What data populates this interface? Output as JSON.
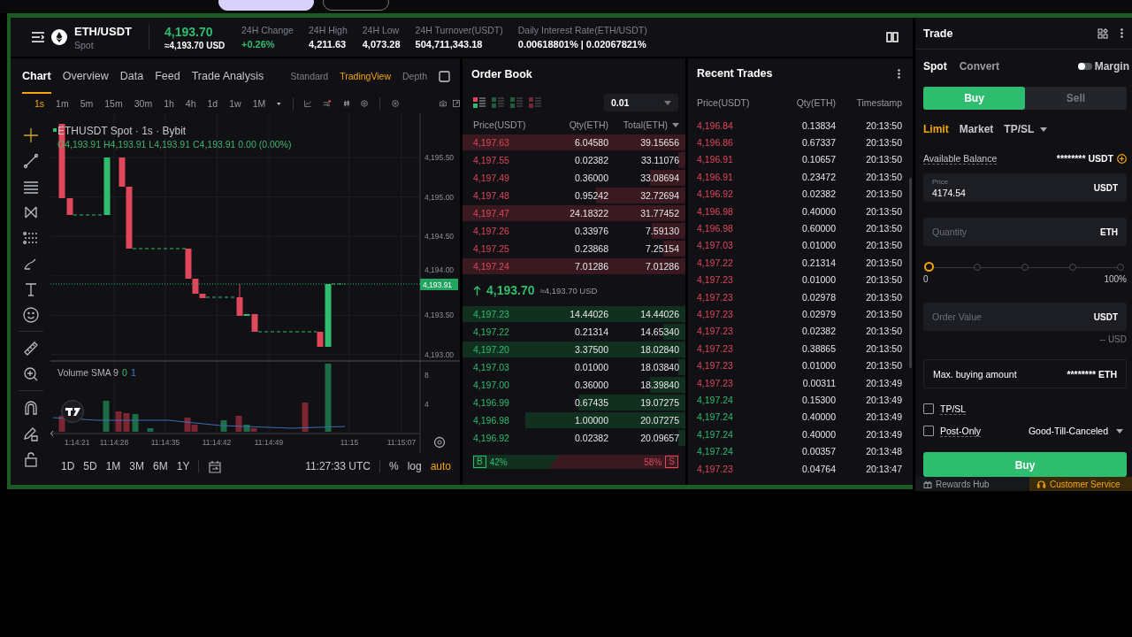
{
  "browser_tabs": [
    {
      "selected": true
    },
    {
      "selected": false
    }
  ],
  "header": {
    "pair": "ETH/USDT",
    "market": "Spot",
    "last_price": "4,193.70",
    "last_price_usd": "≈4,193.70 USD",
    "stats": [
      {
        "label": "24H Change",
        "value": "+0.26%",
        "kind": "up"
      },
      {
        "label": "24H High",
        "value": "4,211.63",
        "kind": "plain"
      },
      {
        "label": "24H Low",
        "value": "4,073.28",
        "kind": "plain"
      },
      {
        "label": "24H Turnover(USDT)",
        "value": "504,711,343.18",
        "kind": "plain"
      },
      {
        "label": "Daily Interest Rate(ETH/USDT)",
        "value": "0.00618801% | 0.02067821%",
        "kind": "plain"
      }
    ]
  },
  "chart": {
    "tabs": [
      {
        "label": "Chart",
        "selected": true
      },
      {
        "label": "Overview",
        "selected": false
      },
      {
        "label": "Data",
        "selected": false
      },
      {
        "label": "Feed",
        "selected": false
      },
      {
        "label": "Trade Analysis",
        "selected": false
      }
    ],
    "views": [
      {
        "label": "Standard",
        "selected": false
      },
      {
        "label": "TradingView",
        "selected": true
      },
      {
        "label": "Depth",
        "selected": false
      }
    ],
    "intervals": [
      {
        "label": "1s",
        "selected": true
      },
      {
        "label": "1m",
        "selected": false
      },
      {
        "label": "5m",
        "selected": false
      },
      {
        "label": "15m",
        "selected": false
      },
      {
        "label": "30m",
        "selected": false
      },
      {
        "label": "1h",
        "selected": false
      },
      {
        "label": "4h",
        "selected": false
      },
      {
        "label": "1d",
        "selected": false
      },
      {
        "label": "1w",
        "selected": false
      },
      {
        "label": "1M",
        "selected": false
      }
    ],
    "legend": "ETHUSDT Spot · 1s · Bybit",
    "ohlc": "O4,193.91 H4,193.91 L4,193.91 C4,193.91 0.00 (0.00%)",
    "volume_legend": "Volume SMA 9",
    "volume_values": [
      "0",
      "1"
    ],
    "price_ticks": [
      "4,195.50",
      "4,195.00",
      "4,194.50",
      "4,194.00",
      "4,193.50",
      "4,193.00"
    ],
    "current_price": "4,193.91",
    "volume_ticks": [
      "8",
      "4"
    ],
    "time_ticks": [
      "1:14:21",
      "11:14:28",
      "11:14:35",
      "11:14:42",
      "11:14:49",
      "11:15",
      "11:15:07"
    ],
    "ranges": [
      "1D",
      "5D",
      "1M",
      "3M",
      "6M",
      "1Y"
    ],
    "clock": "11:27:33 UTC",
    "scale_options": [
      {
        "label": "%",
        "selected": false
      },
      {
        "label": "log",
        "selected": false
      },
      {
        "label": "auto",
        "selected": true
      }
    ]
  },
  "order_book": {
    "title": "Order Book",
    "layouts": [
      {
        "selected": true
      },
      {
        "selected": false
      },
      {
        "selected": false
      },
      {
        "selected": false
      }
    ],
    "step": "0.01",
    "columns": [
      "Price(USDT)",
      "Qty(ETH)",
      "Total(ETH)"
    ],
    "asks": [
      {
        "price": "4,197.63",
        "qty": "6.04580",
        "total": "39.15656"
      },
      {
        "price": "4,197.55",
        "qty": "0.02382",
        "total": "33.11076"
      },
      {
        "price": "4,197.49",
        "qty": "0.36000",
        "total": "33.08694"
      },
      {
        "price": "4,197.48",
        "qty": "0.95242",
        "total": "32.72694"
      },
      {
        "price": "4,197.47",
        "qty": "24.18322",
        "total": "31.77452"
      },
      {
        "price": "4,197.26",
        "qty": "0.33976",
        "total": "7.59130"
      },
      {
        "price": "4,197.25",
        "qty": "0.23868",
        "total": "7.25154"
      },
      {
        "price": "4,197.24",
        "qty": "7.01286",
        "total": "7.01286"
      }
    ],
    "mid_price": "4,193.70",
    "mid_usd": "≈4,193.70 USD",
    "bids": [
      {
        "price": "4,197.23",
        "qty": "14.44026",
        "total": "14.44026"
      },
      {
        "price": "4,197.22",
        "qty": "0.21314",
        "total": "14.65340"
      },
      {
        "price": "4,197.20",
        "qty": "3.37500",
        "total": "18.02840"
      },
      {
        "price": "4,197.03",
        "qty": "0.01000",
        "total": "18.03840"
      },
      {
        "price": "4,197.00",
        "qty": "0.36000",
        "total": "18.39840"
      },
      {
        "price": "4,196.99",
        "qty": "0.67435",
        "total": "19.07275"
      },
      {
        "price": "4,196.98",
        "qty": "1.00000",
        "total": "20.07275"
      },
      {
        "price": "4,196.92",
        "qty": "0.02382",
        "total": "20.09657"
      }
    ],
    "ratio": {
      "buy_mark": "B",
      "buy": "42%",
      "sell": "58%",
      "sell_mark": "S",
      "level": 0.42
    }
  },
  "recent_trades": {
    "title": "Recent Trades",
    "columns": [
      "Price(USDT)",
      "Qty(ETH)",
      "Timestamp"
    ],
    "rows": [
      {
        "price": "4,196.84",
        "qty": "0.13834",
        "time": "20:13:50",
        "buy": false
      },
      {
        "price": "4,196.86",
        "qty": "0.67337",
        "time": "20:13:50",
        "buy": false
      },
      {
        "price": "4,196.91",
        "qty": "0.10657",
        "time": "20:13:50",
        "buy": false
      },
      {
        "price": "4,196.91",
        "qty": "0.23472",
        "time": "20:13:50",
        "buy": false
      },
      {
        "price": "4,196.92",
        "qty": "0.02382",
        "time": "20:13:50",
        "buy": false
      },
      {
        "price": "4,196.98",
        "qty": "0.40000",
        "time": "20:13:50",
        "buy": false
      },
      {
        "price": "4,196.98",
        "qty": "0.60000",
        "time": "20:13:50",
        "buy": false
      },
      {
        "price": "4,197.03",
        "qty": "0.01000",
        "time": "20:13:50",
        "buy": false
      },
      {
        "price": "4,197.22",
        "qty": "0.21314",
        "time": "20:13:50",
        "buy": false
      },
      {
        "price": "4,197.23",
        "qty": "0.01000",
        "time": "20:13:50",
        "buy": false
      },
      {
        "price": "4,197.23",
        "qty": "0.02978",
        "time": "20:13:50",
        "buy": false
      },
      {
        "price": "4,197.23",
        "qty": "0.02979",
        "time": "20:13:50",
        "buy": false
      },
      {
        "price": "4,197.23",
        "qty": "0.02382",
        "time": "20:13:50",
        "buy": false
      },
      {
        "price": "4,197.23",
        "qty": "0.38865",
        "time": "20:13:50",
        "buy": false
      },
      {
        "price": "4,197.23",
        "qty": "0.01000",
        "time": "20:13:50",
        "buy": false
      },
      {
        "price": "4,197.23",
        "qty": "0.00311",
        "time": "20:13:49",
        "buy": false
      },
      {
        "price": "4,197.24",
        "qty": "0.15300",
        "time": "20:13:49",
        "buy": true
      },
      {
        "price": "4,197.24",
        "qty": "0.40000",
        "time": "20:13:49",
        "buy": true
      },
      {
        "price": "4,197.24",
        "qty": "0.40000",
        "time": "20:13:49",
        "buy": true
      },
      {
        "price": "4,197.24",
        "qty": "0.00357",
        "time": "20:13:48",
        "buy": true
      },
      {
        "price": "4,197.23",
        "qty": "0.04764",
        "time": "20:13:47",
        "buy": false
      }
    ]
  },
  "trade": {
    "title": "Trade",
    "modes": [
      {
        "label": "Spot",
        "selected": true
      },
      {
        "label": "Convert",
        "selected": false
      }
    ],
    "margin": {
      "label": "Margin",
      "on": false
    },
    "sides": [
      {
        "label": "Buy",
        "selected": true
      },
      {
        "label": "Sell",
        "selected": false
      }
    ],
    "order_types": [
      {
        "label": "Limit",
        "selected": true
      },
      {
        "label": "Market",
        "selected": false
      },
      {
        "label": "TP/SL",
        "selected": false
      }
    ],
    "balance": {
      "label": "Available Balance",
      "value": "******** USDT"
    },
    "price_field": {
      "label": "Price",
      "value": "4174.54",
      "unit": "USDT"
    },
    "quantity_field": {
      "placeholder": "Quantity",
      "unit": "ETH"
    },
    "slider": {
      "level": 0,
      "min_label": "0",
      "max_label": "100%"
    },
    "order_value_field": {
      "placeholder": "Order Value",
      "unit": "USDT"
    },
    "usd_estimate": "-- USD",
    "max_buy": {
      "label": "Max. buying amount",
      "value": "******** ETH"
    },
    "options": [
      {
        "label": "TP/SL",
        "checked": false
      },
      {
        "label": "Post-Only",
        "checked": false
      }
    ],
    "time_in_force": "Good-Till-Canceled",
    "submit": "Buy",
    "footer": {
      "rewards": "Rewards Hub",
      "service": "Customer Service"
    }
  }
}
